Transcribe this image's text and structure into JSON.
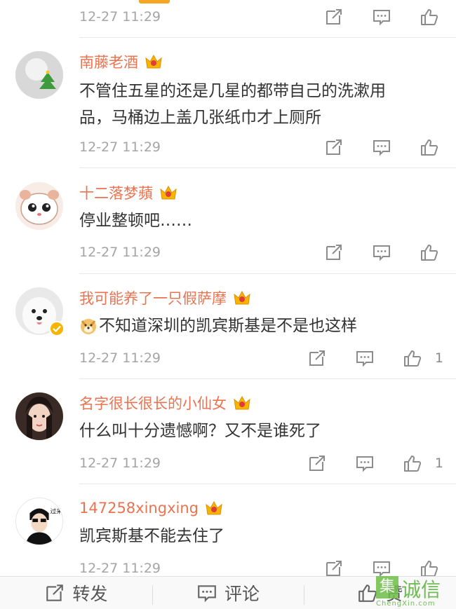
{
  "top_meta": {
    "time": "12-27 11:29"
  },
  "comments": [
    {
      "name": "南藤老酒",
      "avatar": "christmas-tree-avatar",
      "text_lines": [
        "不管住五星的还是几星的都带自己的洗漱用",
        "品，马桶边上盖几张纸巾才上厕所"
      ],
      "time": "12-27 11:29",
      "likes": ""
    },
    {
      "name": "十二落梦蘋",
      "avatar": "hamster-avatar",
      "text_lines": [
        "停业整顿吧……"
      ],
      "time": "12-27 11:29",
      "likes": ""
    },
    {
      "name": "我可能养了一只假萨摩",
      "avatar": "samoyed-avatar",
      "text_lines": [
        "不知道深圳的凯宾斯基是不是也这样"
      ],
      "time": "12-27 11:29",
      "likes": "1"
    },
    {
      "name": "名字很长很长的小仙女",
      "avatar": "girl-avatar",
      "text_lines": [
        "什么叫十分遗憾啊？又不是谁死了"
      ],
      "time": "12-27 11:29",
      "likes": "1"
    },
    {
      "name": "147258xingxing",
      "avatar": "cartoon-man-avatar",
      "text_lines": [
        "凯宾斯基不能去住了"
      ],
      "time": "12-27 11:29",
      "likes": ""
    }
  ],
  "bottom_bar": {
    "repost": "转发",
    "comment": "评论",
    "like": "赞"
  },
  "watermark": {
    "box": "集",
    "text": "诚信",
    "sub": "ChengXin.com"
  },
  "colors": {
    "name": "#eb7350",
    "time": "#a5a5a5",
    "accent": "#f5a623"
  }
}
